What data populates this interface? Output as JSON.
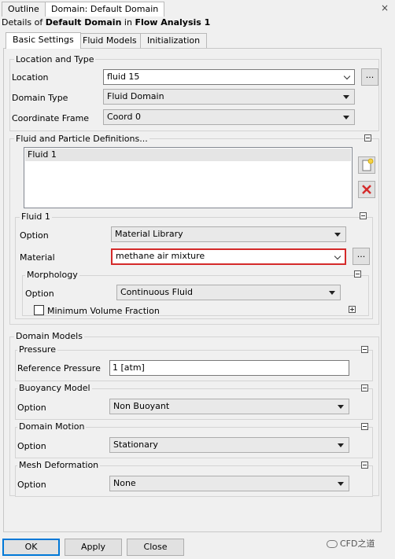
{
  "tabs": {
    "outline": "Outline",
    "domain": "Domain: Default Domain",
    "close": "×"
  },
  "details": {
    "prefix": "Details of ",
    "object": "Default Domain",
    "mid": " in ",
    "analysis": "Flow Analysis 1"
  },
  "subtabs": {
    "basic": "Basic Settings",
    "fluid_models": "Fluid Models",
    "init": "Initialization"
  },
  "location_type": {
    "title": "Location and Type",
    "location_label": "Location",
    "location_value": "fluid 15",
    "domain_type_label": "Domain Type",
    "domain_type_value": "Fluid Domain",
    "coord_label": "Coordinate Frame",
    "coord_value": "Coord 0",
    "browse": "..."
  },
  "fluid_defs": {
    "title": "Fluid and Particle Definitions...",
    "items": [
      "Fluid 1"
    ]
  },
  "fluid1": {
    "title": "Fluid 1",
    "option_label": "Option",
    "option_value": "Material Library",
    "material_label": "Material",
    "material_value": "methane air mixture",
    "browse": "...",
    "morphology": {
      "title": "Morphology",
      "option_label": "Option",
      "option_value": "Continuous Fluid",
      "min_vol_label": "Minimum Volume Fraction"
    }
  },
  "domain_models": {
    "title": "Domain Models",
    "pressure": {
      "title": "Pressure",
      "ref_label": "Reference Pressure",
      "ref_value": "1 [atm]"
    },
    "buoyancy": {
      "title": "Buoyancy Model",
      "option_label": "Option",
      "option_value": "Non Buoyant"
    },
    "motion": {
      "title": "Domain Motion",
      "option_label": "Option",
      "option_value": "Stationary"
    },
    "mesh": {
      "title": "Mesh Deformation",
      "option_label": "Option",
      "option_value": "None"
    }
  },
  "buttons": {
    "ok": "OK",
    "apply": "Apply",
    "close": "Close"
  },
  "watermark": "CFD之道",
  "colors": {
    "highlight": "#d42a2a",
    "default_button": "#0078d7",
    "delete_icon": "#d42a2a"
  }
}
